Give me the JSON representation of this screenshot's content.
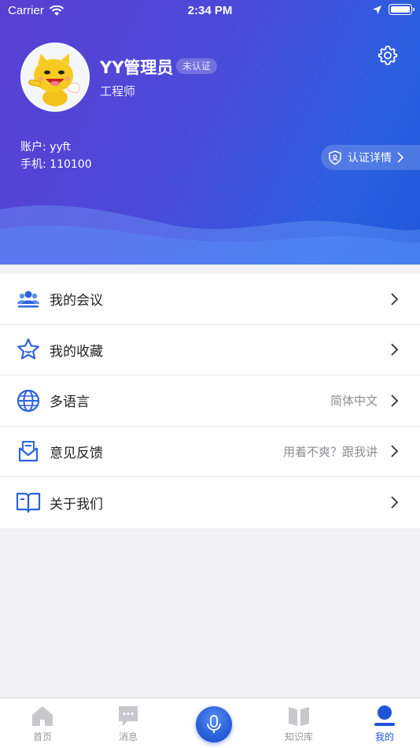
{
  "status_bar": {
    "carrier": "Carrier",
    "time": "2:34 PM"
  },
  "profile": {
    "name": "YY管理员",
    "badge": "未认证",
    "role": "工程师",
    "account_line": "账户: yyft",
    "phone_line": "手机: 110100",
    "verify_label": "认证详情"
  },
  "menu": {
    "items": [
      {
        "label": "我的会议",
        "value": "",
        "icon": "people-icon"
      },
      {
        "label": "我的收藏",
        "value": "",
        "icon": "star-icon"
      },
      {
        "label": "多语言",
        "value": "简体中文",
        "icon": "globe-icon"
      },
      {
        "label": "意见反馈",
        "value": "用着不爽？跟我讲",
        "icon": "mail-icon"
      },
      {
        "label": "关于我们",
        "value": "",
        "icon": "book-icon"
      }
    ]
  },
  "tabbar": {
    "tabs": [
      {
        "label": "首页",
        "icon": "home-icon"
      },
      {
        "label": "消息",
        "icon": "chat-icon"
      },
      {
        "label": "",
        "icon": "mic-icon"
      },
      {
        "label": "知识库",
        "icon": "book-open-icon"
      },
      {
        "label": "我的",
        "icon": "person-icon"
      }
    ],
    "active_color": "#1f56d8",
    "inactive_color": "#999999"
  },
  "colors": {
    "header_start": "#5a3fd3",
    "header_end": "#1f56d8",
    "menu_icon": "#2c63dd"
  }
}
